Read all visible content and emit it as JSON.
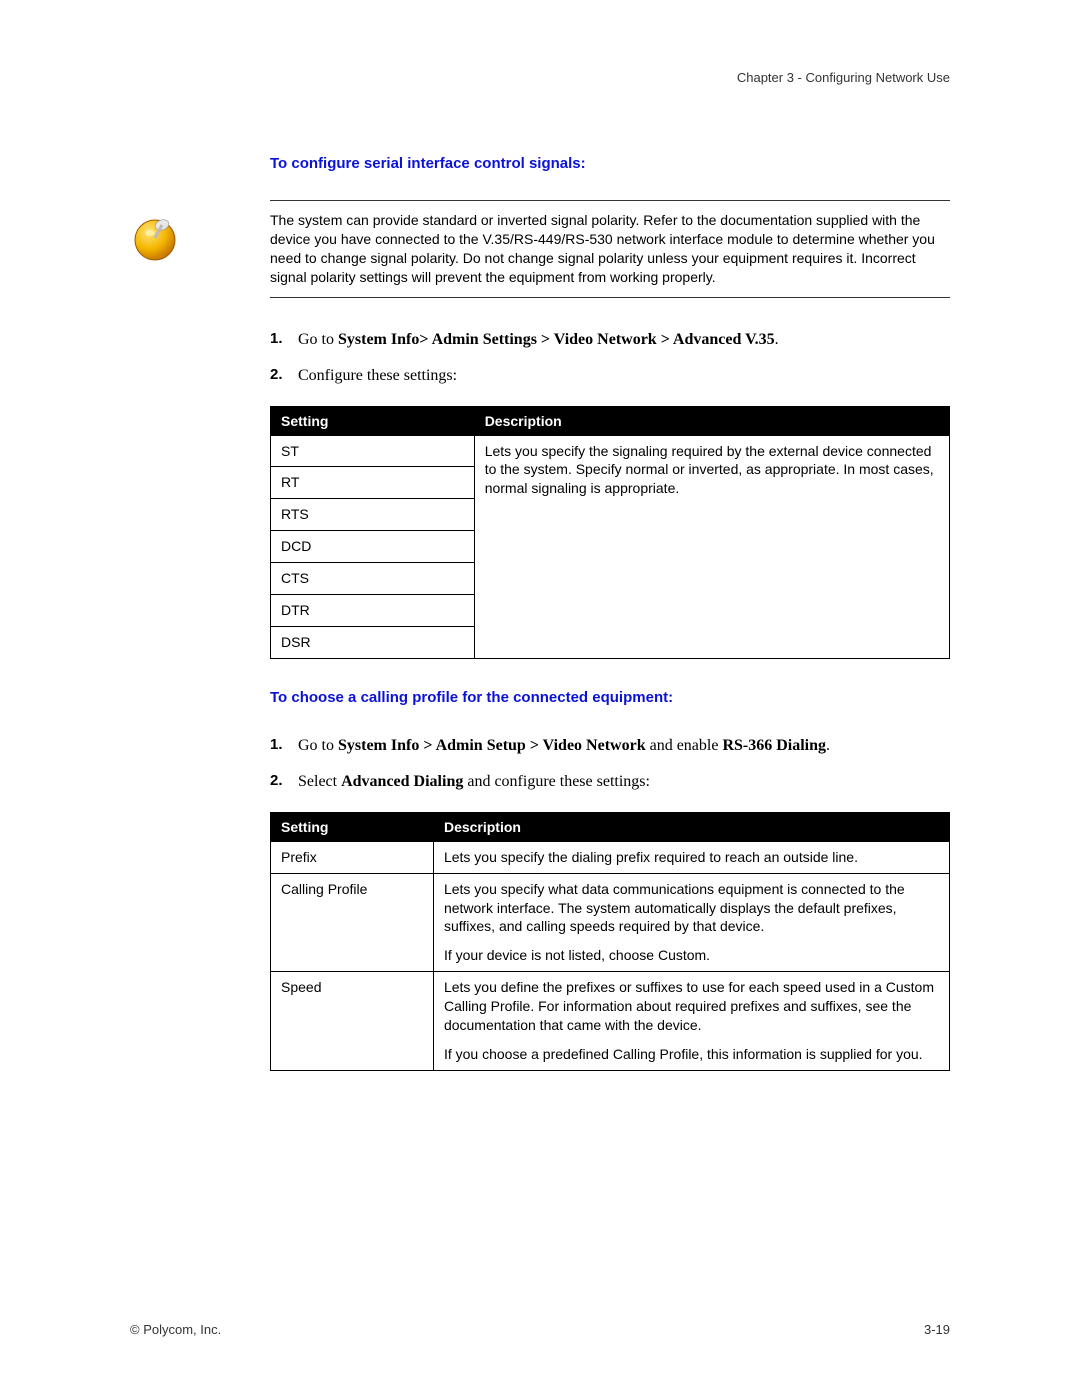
{
  "header": {
    "chapter": "Chapter 3 - Configuring Network Use"
  },
  "section1": {
    "heading": "To configure serial interface control signals:",
    "note": "The system can provide standard or inverted signal polarity. Refer to the documentation supplied with the device you have connected to the V.35/RS-449/RS-530 network interface module to determine whether you need to change signal polarity. Do not change signal polarity unless your equipment requires it. Incorrect signal polarity settings will prevent the equipment from working properly.",
    "step1_pre": "Go to ",
    "step1_bold": "System Info> Admin Settings > Video Network > Advanced V.35",
    "step1_post": ".",
    "step2": "Configure these settings:",
    "table": {
      "col_setting": "Setting",
      "col_desc": "Description",
      "rows": [
        "ST",
        "RT",
        "RTS",
        "DCD",
        "CTS",
        "DTR",
        "DSR"
      ],
      "desc": "Lets you specify the signaling required by the external device connected to the system. Specify normal or inverted, as appropriate. In most cases, normal signaling is appropriate."
    }
  },
  "section2": {
    "heading": "To choose a calling profile for the connected equipment:",
    "step1_pre": "Go to ",
    "step1_b1": "System Info > Admin Setup > Video Network",
    "step1_mid": " and enable ",
    "step1_b2": "RS-366 Dialing",
    "step1_post": ".",
    "step2_pre": "Select ",
    "step2_bold": "Advanced Dialing",
    "step2_post": " and configure these settings:",
    "table": {
      "col_setting": "Setting",
      "col_desc": "Description",
      "rows": [
        {
          "setting": "Prefix",
          "desc": [
            "Lets you specify the dialing prefix required to reach an outside line."
          ]
        },
        {
          "setting": "Calling Profile",
          "desc": [
            "Lets you specify what data communications equipment is connected to the network interface. The system automatically displays the default prefixes, suffixes, and calling speeds required by that device.",
            "If your device is not listed, choose Custom."
          ]
        },
        {
          "setting": "Speed",
          "desc": [
            "Lets you define the prefixes or suffixes to use for each speed used in a Custom Calling Profile. For information about required prefixes and suffixes, see the documentation that came with the device.",
            "If you choose a predefined Calling Profile, this information is supplied for you."
          ]
        }
      ]
    }
  },
  "footer": {
    "left": "© Polycom, Inc.",
    "right": "3-19"
  }
}
